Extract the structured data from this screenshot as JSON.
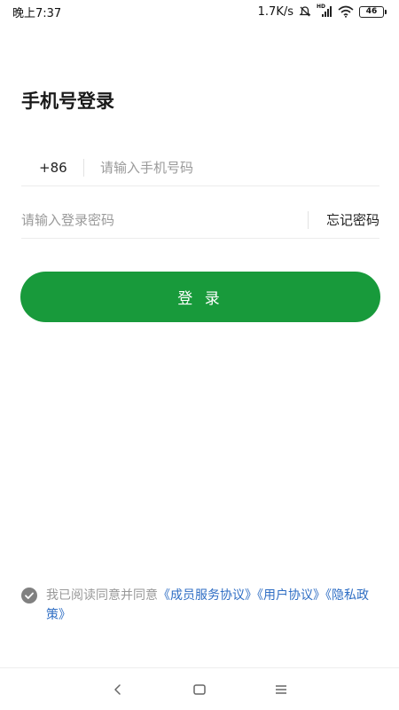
{
  "status_bar": {
    "time": "晚上7:37",
    "net_speed": "1.7K/s",
    "hd_label": "HD",
    "battery_level": "46"
  },
  "login": {
    "title": "手机号登录",
    "country_code": "+86",
    "phone_placeholder": "请输入手机号码",
    "password_placeholder": "请输入登录密码",
    "forgot_password": "忘记密码",
    "login_button": "登 录"
  },
  "agreement": {
    "checked": true,
    "prefix": "我已阅读同意并同意",
    "links": [
      "《成员服务协议》",
      "《用户协议》",
      "《隐私政策》"
    ]
  },
  "nav_bar": {
    "icons": [
      "back-icon",
      "home-icon",
      "menu-icon"
    ]
  },
  "colors": {
    "primary_green": "#189a3b",
    "link_blue": "#2f6ec4",
    "muted_text": "#999999"
  }
}
